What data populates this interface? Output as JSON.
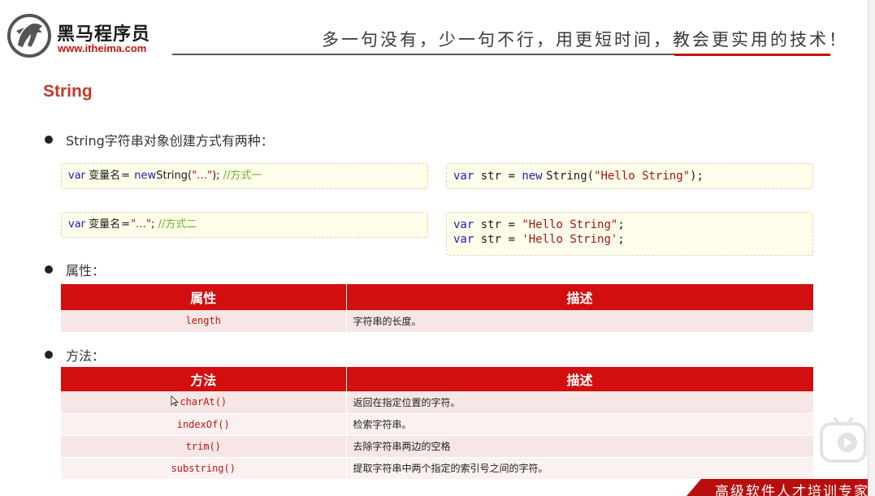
{
  "header": {
    "brand_cn": "黑马程序员",
    "brand_url": "www.itheima.com",
    "slogan": "多一句没有，少一句不行，用更短时间，教会更实用的技术！"
  },
  "page_title": "String",
  "bullets": {
    "create": "String字符串对象创建方式有两种：",
    "props": "属性：",
    "methods": "方法："
  },
  "code": {
    "syntax1": {
      "kw_var": "var",
      "name": "变量名",
      "eq": "=",
      "kw_new": "new",
      "cls": "String(",
      "arg": "\"…\"",
      "close": ");",
      "comment": "//方式一"
    },
    "syntax2": {
      "kw_var": "var",
      "name": "变量名",
      "eq": "=",
      "arg": "\"…\"",
      "close": ";",
      "comment": "//方式二"
    },
    "example1": {
      "kw_var": "var",
      "ident": "str =",
      "kw_new": "new",
      "cls": "String(",
      "arg": "\"Hello String\"",
      "close": ");"
    },
    "example2": [
      {
        "kw_var": "var",
        "ident": "str =",
        "arg": "\"Hello String\"",
        "close": ";"
      },
      {
        "kw_var": "var",
        "ident": "str =",
        "arg": "'Hello String'",
        "close": ";"
      }
    ]
  },
  "props_table": {
    "headers": [
      "属性",
      "描述"
    ],
    "rows": [
      {
        "name": "length",
        "desc": "字符串的长度。"
      }
    ]
  },
  "methods_table": {
    "headers": [
      "方法",
      "描述"
    ],
    "rows": [
      {
        "name": "charAt()",
        "desc": "返回在指定位置的字符。"
      },
      {
        "name": "indexOf()",
        "desc": "检索字符串。"
      },
      {
        "name": "trim()",
        "desc": "去除字符串两边的空格"
      },
      {
        "name": "substring()",
        "desc": "提取字符串中两个指定的索引号之间的字符。"
      }
    ]
  },
  "footer": {
    "text": "高级软件人才培训专家"
  },
  "colors": {
    "accent_red": "#c3150a",
    "table_header": "#d20e0e",
    "keyword_blue": "#1b1bc4",
    "string_red": "#a31515",
    "comment_green": "#6bb52f"
  },
  "icons": {
    "logo": "horse-logo-icon",
    "play": "play-icon",
    "cursor": "mouse-cursor-icon"
  }
}
